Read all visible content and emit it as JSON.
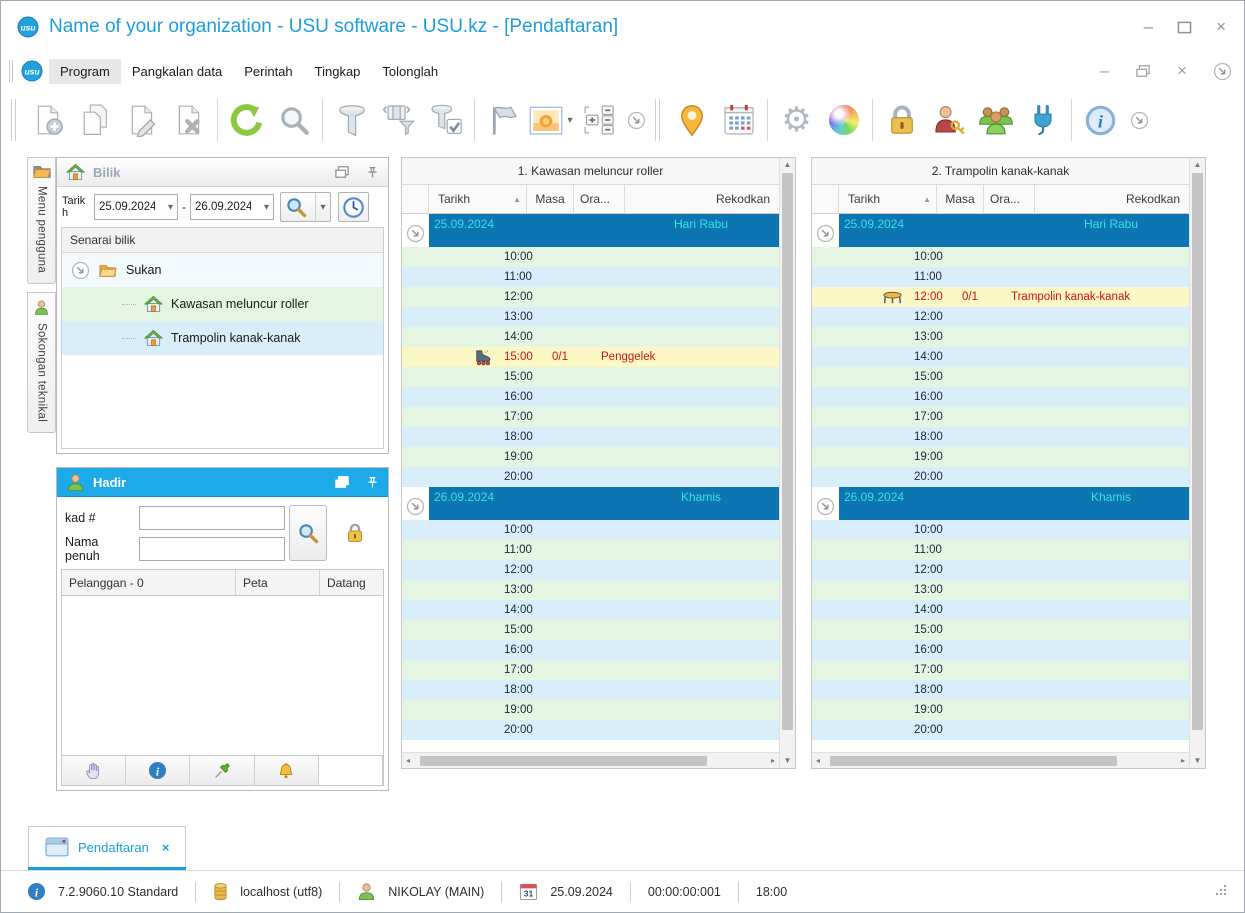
{
  "window": {
    "title": "Name of your organization - USU software - USU.kz - [Pendaftaran]",
    "logo": "usu-logo-icon",
    "controls": [
      {
        "name": "minimize-button",
        "glyph": "–"
      },
      {
        "name": "maximize-button",
        "icon": "maximize-icon"
      },
      {
        "name": "close-button",
        "glyph": "×"
      }
    ]
  },
  "menu": {
    "items": [
      {
        "label": "Program",
        "active": true
      },
      {
        "label": "Pangkalan data",
        "active": false
      },
      {
        "label": "Perintah",
        "active": false
      },
      {
        "label": "Tingkap",
        "active": false
      },
      {
        "label": "Tolonglah",
        "active": false
      }
    ],
    "mdi_controls": [
      {
        "name": "mdi-minimize-button",
        "glyph": "–"
      },
      {
        "name": "mdi-restore-button",
        "icon": "restore-icon"
      },
      {
        "name": "mdi-close-button",
        "glyph": "×"
      },
      {
        "name": "menu-overflow-button",
        "icon": "chevron-circle-icon"
      }
    ]
  },
  "toolbar": [
    {
      "sep": "grip"
    },
    {
      "icon": "new-document-icon"
    },
    {
      "icon": "copy-document-icon"
    },
    {
      "icon": "edit-document-icon"
    },
    {
      "icon": "delete-document-icon"
    },
    {
      "sep": "line"
    },
    {
      "icon": "refresh-icon"
    },
    {
      "icon": "search-icon"
    },
    {
      "sep": "line"
    },
    {
      "icon": "filter-icon"
    },
    {
      "icon": "filter-columns-icon"
    },
    {
      "icon": "filter-apply-icon"
    },
    {
      "sep": "line"
    },
    {
      "icon": "flag-icon"
    },
    {
      "icon": "picture-icon",
      "caret": true
    },
    {
      "icon": "counters-icon"
    },
    {
      "icon": "chevron-circle-icon",
      "small": true
    },
    {
      "sep": "grip"
    },
    {
      "icon": "map-pin-icon"
    },
    {
      "icon": "calendar-icon"
    },
    {
      "sep": "line"
    },
    {
      "icon": "settings-gear-icon"
    },
    {
      "icon": "color-sphere-icon"
    },
    {
      "sep": "line"
    },
    {
      "icon": "lock-icon"
    },
    {
      "icon": "user-key-icon"
    },
    {
      "icon": "user-groups-icon"
    },
    {
      "icon": "plug-icon"
    },
    {
      "sep": "line"
    },
    {
      "icon": "info-icon"
    },
    {
      "icon": "chevron-circle-icon",
      "small": true
    }
  ],
  "side_tabs": [
    {
      "icon": "folder-icon",
      "label": "Menu pengguna"
    },
    {
      "icon": "support-person-icon",
      "label": "Sokongan teknikal"
    }
  ],
  "bilik_panel": {
    "icon": "home-icon",
    "title": "Bilik",
    "date_label": "Tarikh",
    "date_from": "25.09.2024",
    "date_to": "26.09.2024",
    "range_separator": "-",
    "list_header": "Senarai bilik",
    "tree": {
      "root": {
        "icon": "folder-open-icon",
        "label": "Sukan"
      },
      "children": [
        {
          "icon": "home-icon",
          "label": "Kawasan meluncur roller",
          "tint": "green"
        },
        {
          "icon": "home-icon",
          "label": "Trampolin kanak-kanak",
          "tint": "blue"
        }
      ]
    }
  },
  "hadir_panel": {
    "icon": "person-icon",
    "title": "Hadir",
    "fields": [
      {
        "label": "kad #",
        "value": ""
      },
      {
        "label": "Nama penuh",
        "value": ""
      }
    ],
    "table_columns": [
      "Pelanggan - 0",
      "Peta",
      "Datang"
    ],
    "footer_icons": [
      "hand-icon",
      "info-round-icon",
      "pushpin-icon",
      "bell-icon"
    ]
  },
  "schedules": [
    {
      "title": "1. Kawasan meluncur roller",
      "columns": [
        "Tarikh",
        "Masa",
        "Ora...",
        "Rekodkan"
      ],
      "sort_indicator": "▲",
      "groups": [
        {
          "date": "25.09.2024",
          "day": "Hari Rabu",
          "rows": [
            {
              "time": "10:00"
            },
            {
              "time": "11:00"
            },
            {
              "time": "12:00"
            },
            {
              "time": "13:00"
            },
            {
              "time": "14:00"
            },
            {
              "time": "15:00",
              "occupancy": "0/1",
              "label": "Penggelek",
              "event": true,
              "icon": "roller-skate-icon"
            },
            {
              "time": "15:00"
            },
            {
              "time": "16:00"
            },
            {
              "time": "17:00"
            },
            {
              "time": "18:00"
            },
            {
              "time": "19:00"
            },
            {
              "time": "20:00"
            }
          ]
        },
        {
          "date": "26.09.2024",
          "day": "Khamis",
          "rows": [
            {
              "time": "10:00"
            },
            {
              "time": "11:00"
            },
            {
              "time": "12:00"
            },
            {
              "time": "13:00"
            },
            {
              "time": "14:00"
            },
            {
              "time": "15:00"
            },
            {
              "time": "16:00"
            },
            {
              "time": "17:00"
            },
            {
              "time": "18:00"
            },
            {
              "time": "19:00"
            },
            {
              "time": "20:00"
            }
          ]
        }
      ]
    },
    {
      "title": "2. Trampolin kanak-kanak",
      "columns": [
        "Tarikh",
        "Masa",
        "Ora...",
        "Rekodkan"
      ],
      "sort_indicator": "▲",
      "groups": [
        {
          "date": "25.09.2024",
          "day": "Hari Rabu",
          "rows": [
            {
              "time": "10:00"
            },
            {
              "time": "11:00"
            },
            {
              "time": "12:00",
              "occupancy": "0/1",
              "label": "Trampolin kanak-kanak",
              "event": true,
              "icon": "trampoline-icon"
            },
            {
              "time": "12:00"
            },
            {
              "time": "13:00"
            },
            {
              "time": "14:00"
            },
            {
              "time": "15:00"
            },
            {
              "time": "16:00"
            },
            {
              "time": "17:00"
            },
            {
              "time": "18:00"
            },
            {
              "time": "19:00"
            },
            {
              "time": "20:00"
            }
          ]
        },
        {
          "date": "26.09.2024",
          "day": "Khamis",
          "rows": [
            {
              "time": "10:00"
            },
            {
              "time": "11:00"
            },
            {
              "time": "12:00"
            },
            {
              "time": "13:00"
            },
            {
              "time": "14:00"
            },
            {
              "time": "15:00"
            },
            {
              "time": "16:00"
            },
            {
              "time": "17:00"
            },
            {
              "time": "18:00"
            },
            {
              "time": "19:00"
            },
            {
              "time": "20:00"
            }
          ]
        }
      ]
    }
  ],
  "footer_tab": {
    "icon": "window-icon",
    "label": "Pendaftaran",
    "close_glyph": "×"
  },
  "status_bar": {
    "items": [
      {
        "icon": "info-round-icon",
        "text": "7.2.9060.10 Standard"
      },
      {
        "icon": "database-icon",
        "text": "localhost (utf8)"
      },
      {
        "icon": "user-icon",
        "text": "NIKOLAY (MAIN)"
      },
      {
        "icon": "calendar-31-icon",
        "text": "25.09.2024"
      },
      {
        "icon": null,
        "text": "00:00:00:001"
      },
      {
        "icon": null,
        "text": "18:00"
      }
    ]
  },
  "colors": {
    "title_text": "#1c9ede",
    "hadir_header": "#1ea9e8",
    "group_row_bg": "#0c75b2",
    "group_row_text": "#37e3e3",
    "stripe_green": "#e4f6e2",
    "stripe_blue": "#d8effb",
    "event_bg": "#fcf8c6",
    "event_text": "#cc1414",
    "tab_accent": "#1c9ede"
  }
}
